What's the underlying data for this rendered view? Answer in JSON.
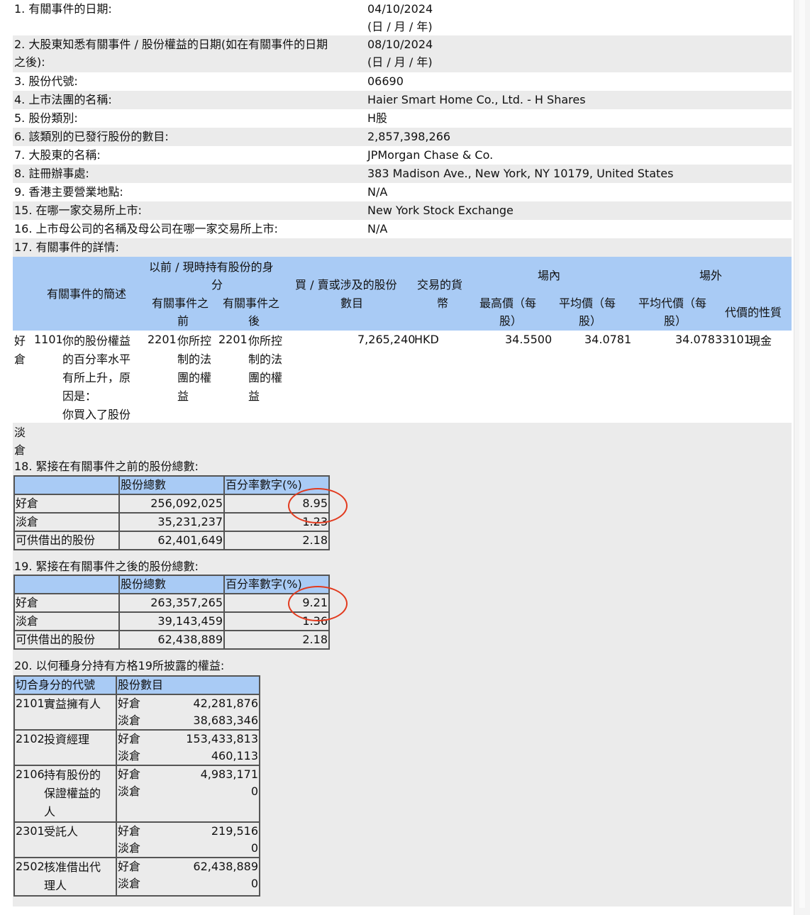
{
  "top_rows": [
    {
      "label": "1. 有關事件的日期:",
      "value": "04/10/2024",
      "value2": "(日 / 月 / 年)"
    },
    {
      "label": "2. 大股東知悉有關事件 / 股份權益的日期(如在有關事件的日期",
      "label2": "之後):",
      "value": "08/10/2024",
      "value2": "(日 / 月 / 年)"
    },
    {
      "label": "3. 股份代號:",
      "value": "06690"
    },
    {
      "label": "4. 上市法團的名稱:",
      "value": "Haier Smart Home Co., Ltd. - H Shares"
    },
    {
      "label": "5. 股份類別:",
      "value": "H股"
    },
    {
      "label": "6. 該類別的已發行股份的數目:",
      "value": "2,857,398,266"
    },
    {
      "label": "7. 大股東的名稱:",
      "value": "JPMorgan Chase & Co."
    },
    {
      "label": "8. 註冊辦事處:",
      "value": "383 Madison Ave., New York, NY 10179, United States"
    },
    {
      "label": "9. 香港主要營業地點:",
      "value": "N/A"
    },
    {
      "label": "15. 在哪一家交易所上市:",
      "value": "New York Stock Exchange"
    },
    {
      "label": "16. 上市母公司的名稱及母公司在哪一家交易所上市:",
      "value": "N/A"
    }
  ],
  "s17": {
    "title": "17. 有關事件的詳情:",
    "h_desc": "有關事件的簡述",
    "h_capacity": "以前 / 現時持有股份的身",
    "h_capacity2": "分",
    "h_before": "有關事件之",
    "h_before2": "前",
    "h_after": "有關事件之",
    "h_after2": "後",
    "h_shares": "買 / 賣或涉及的股份",
    "h_shares2": "數目",
    "h_currency": "交易的貨",
    "h_currency2": "幣",
    "h_onex": "場內",
    "h_offex": "場外",
    "h_high": "最高價（每",
    "h_high2": "股）",
    "h_avg": "平均價（每",
    "h_avg2": "股）",
    "h_avgcons": "平均代價（每",
    "h_avgcons2": "股）",
    "h_nature": "代價的性質",
    "long": "好",
    "long2": "倉",
    "code": "1101",
    "desc": [
      "你的股份權益",
      "的百分率水平",
      "有所上升，原",
      "因是：",
      "你買入了股份"
    ],
    "before_code": "2201",
    "before_desc": [
      "你所控",
      "制的法",
      "團的權",
      "益"
    ],
    "after_code": "2201",
    "after_desc": [
      "你所控",
      "制的法",
      "團的權",
      "益"
    ],
    "shares": "7,265,240",
    "currency": "HKD",
    "high": "34.5500",
    "avg": "34.0781",
    "avg_cons": "34.07833101",
    "nature": "現金",
    "short": "淡",
    "short2": "倉"
  },
  "s18": {
    "title": "18. 緊接在有關事件之前的股份總數:",
    "h_total": "股份總數",
    "h_pct": "百分率數字(%)",
    "rows": [
      {
        "label": "好倉",
        "total": "256,092,025",
        "pct": "8.95"
      },
      {
        "label": "淡倉",
        "total": "35,231,237",
        "pct": "1.23"
      },
      {
        "label": "可供借出的股份",
        "total": "62,401,649",
        "pct": "2.18"
      }
    ]
  },
  "s19": {
    "title": "19. 緊接在有關事件之後的股份總數:",
    "h_total": "股份總數",
    "h_pct": "百分率數字(%)",
    "rows": [
      {
        "label": "好倉",
        "total": "263,357,265",
        "pct": "9.21"
      },
      {
        "label": "淡倉",
        "total": "39,143,459",
        "pct": "1.36"
      },
      {
        "label": "可供借出的股份",
        "total": "62,438,889",
        "pct": "2.18"
      }
    ]
  },
  "s20": {
    "title": "20. 以何種身分持有方格19所披露的權益:",
    "h_code": "切合身分的代號",
    "h_shares": "股份數目",
    "long": "好倉",
    "short": "淡倉",
    "rows": [
      {
        "code": "2101",
        "name": [
          "實益擁有人"
        ],
        "long": "42,281,876",
        "short": "38,683,346"
      },
      {
        "code": "2102",
        "name": [
          "投資經理"
        ],
        "long": "153,433,813",
        "short": "460,113"
      },
      {
        "code": "2106",
        "name": [
          "持有股份的",
          "保證權益的",
          "人"
        ],
        "long": "4,983,171",
        "short": "0"
      },
      {
        "code": "2301",
        "name": [
          "受託人"
        ],
        "long": "219,516",
        "short": "0"
      },
      {
        "code": "2502",
        "name": [
          "核准借出代",
          "理人"
        ],
        "long": "62,438,889",
        "short": "0"
      }
    ]
  },
  "annotation_color": "#e23a1e"
}
